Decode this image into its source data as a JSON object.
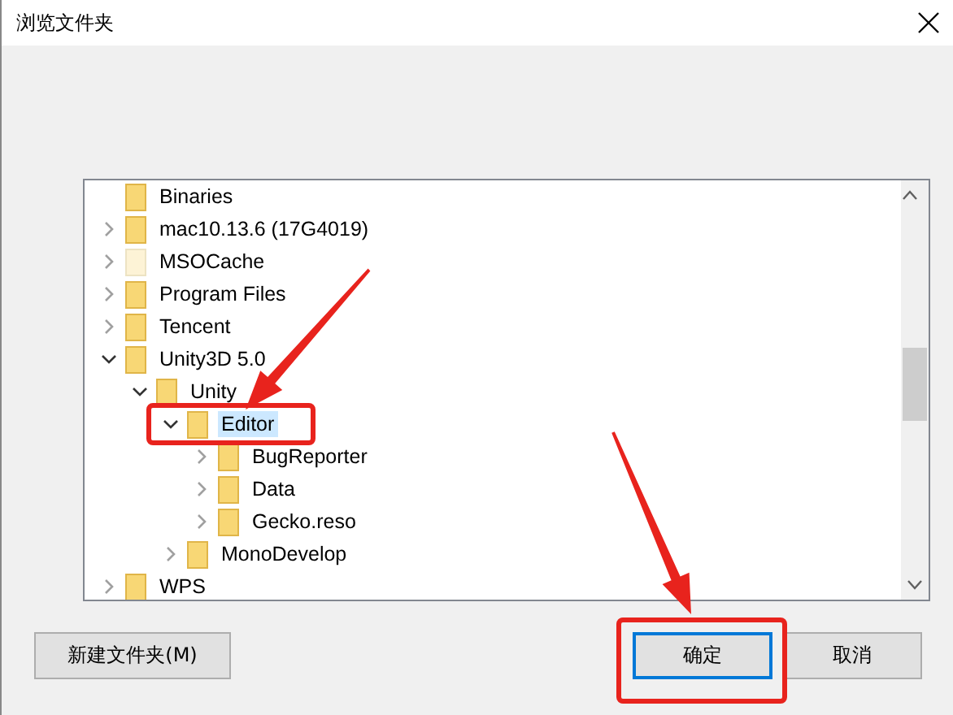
{
  "window": {
    "title": "浏览文件夹"
  },
  "tree": [
    {
      "label": "Binaries",
      "has_children": false,
      "hidden": false,
      "selected": false
    },
    {
      "label": "mac10.13.6  (17G4019)",
      "has_children": true,
      "expanded": false,
      "hidden": false,
      "selected": false
    },
    {
      "label": "MSOCache",
      "has_children": true,
      "expanded": false,
      "hidden": true,
      "selected": false
    },
    {
      "label": "Program Files",
      "has_children": true,
      "expanded": false,
      "hidden": false,
      "selected": false
    },
    {
      "label": "Tencent",
      "has_children": true,
      "expanded": false,
      "hidden": false,
      "selected": false
    },
    {
      "label": "Unity3D 5.0",
      "has_children": true,
      "expanded": true,
      "hidden": false,
      "selected": false,
      "children": [
        {
          "label": "Unity",
          "has_children": true,
          "expanded": true,
          "hidden": false,
          "selected": false,
          "children": [
            {
              "label": "Editor",
              "has_children": true,
              "expanded": true,
              "hidden": false,
              "selected": true,
              "children": [
                {
                  "label": "BugReporter",
                  "has_children": true,
                  "expanded": false,
                  "hidden": false,
                  "selected": false
                },
                {
                  "label": "Data",
                  "has_children": true,
                  "expanded": false,
                  "hidden": false,
                  "selected": false
                },
                {
                  "label": "Gecko.reso",
                  "has_children": true,
                  "expanded": false,
                  "hidden": false,
                  "selected": false
                }
              ]
            },
            {
              "label": "MonoDevelop",
              "has_children": true,
              "expanded": false,
              "hidden": false,
              "selected": false
            }
          ]
        }
      ]
    },
    {
      "label": "WPS",
      "has_children": true,
      "expanded": false,
      "hidden": false,
      "selected": false
    }
  ],
  "buttons": [
    {
      "label": "新建文件夹(M)",
      "kind": "secondary"
    },
    {
      "label": "确定",
      "kind": "default"
    },
    {
      "label": "取消",
      "kind": "secondary"
    }
  ]
}
